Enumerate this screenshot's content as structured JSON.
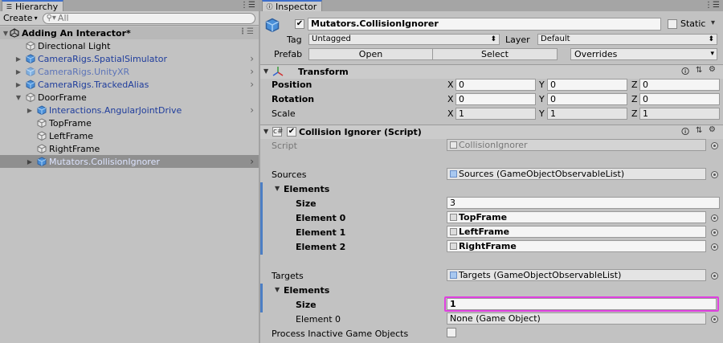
{
  "hierarchy": {
    "tab_label": "Hierarchy",
    "create_label": "Create",
    "search_placeholder": "All",
    "scene_name": "Adding An Interactor*",
    "items": [
      {
        "label": "Directional Light"
      },
      {
        "label": "CameraRigs.SpatialSimulator"
      },
      {
        "label": "CameraRigs.UnityXR"
      },
      {
        "label": "CameraRigs.TrackedAlias"
      },
      {
        "label": "DoorFrame"
      },
      {
        "label": "Interactions.AngularJointDrive"
      },
      {
        "label": "TopFrame"
      },
      {
        "label": "LeftFrame"
      },
      {
        "label": "RightFrame"
      },
      {
        "label": "Mutators.CollisionIgnorer"
      }
    ]
  },
  "inspector": {
    "tab_label": "Inspector",
    "object_name": "Mutators.CollisionIgnorer",
    "static_label": "Static",
    "tag_label": "Tag",
    "tag_value": "Untagged",
    "layer_label": "Layer",
    "layer_value": "Default",
    "prefab_label": "Prefab",
    "open_label": "Open",
    "select_label": "Select",
    "overrides_label": "Overrides",
    "transform": {
      "title": "Transform",
      "position_label": "Position",
      "rotation_label": "Rotation",
      "scale_label": "Scale",
      "axis_x": "X",
      "axis_y": "Y",
      "axis_z": "Z",
      "position": [
        "0",
        "0",
        "0"
      ],
      "rotation": [
        "0",
        "0",
        "0"
      ],
      "scale": [
        "1",
        "1",
        "1"
      ]
    },
    "component": {
      "title": "Collision Ignorer (Script)",
      "script_label": "Script",
      "script_value": "CollisionIgnorer",
      "sources_label": "Sources",
      "sources_value": "Sources (GameObjectObservableList)",
      "elements_label": "Elements",
      "size_label": "Size",
      "sources_size": "3",
      "sources_elements": [
        {
          "label": "Element 0",
          "value": "TopFrame"
        },
        {
          "label": "Element 1",
          "value": "LeftFrame"
        },
        {
          "label": "Element 2",
          "value": "RightFrame"
        }
      ],
      "targets_label": "Targets",
      "targets_value": "Targets (GameObjectObservableList)",
      "targets_elements_label": "Elements",
      "targets_size_label": "Size",
      "targets_size": "1",
      "targets_element0_label": "Element 0",
      "targets_element0_value": "None (Game Object)",
      "process_inactive_label": "Process Inactive Game Objects"
    }
  },
  "colors": {
    "selection_highlight": "#e040e0",
    "tab_accent": "#3c6ecb",
    "prefab_blue": "#1f3d9c"
  }
}
